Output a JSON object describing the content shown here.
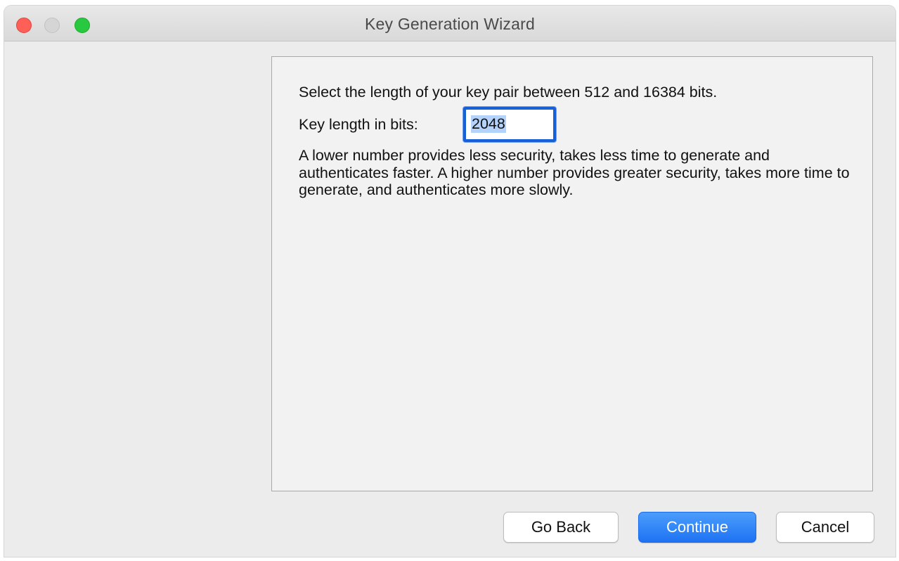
{
  "window": {
    "title": "Key Generation Wizard",
    "traffic_lights": {
      "close": "#fe5f57",
      "minimize": "#d5d5d5",
      "zoom": "#28c840"
    }
  },
  "content": {
    "instruction": "Select the length of your key pair between 512 and 16384 bits.",
    "key_length_label": "Key length in bits:",
    "key_length_value": "2048",
    "description": "A lower number provides less security, takes less time to generate and authenticates faster. A higher number provides greater security, takes more time to generate, and authenticates more slowly."
  },
  "buttons": {
    "go_back": "Go Back",
    "continue": "Continue",
    "cancel": "Cancel"
  },
  "colors": {
    "accent": "#1e72f3",
    "focus_ring": "#1660d8",
    "selection": "#b4d3fb"
  }
}
